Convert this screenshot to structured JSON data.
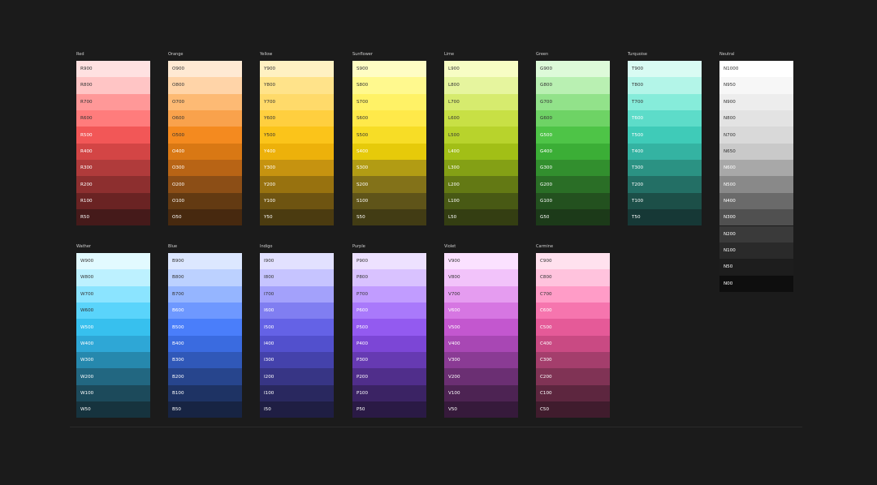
{
  "palettes_row1": [
    {
      "title": "Red",
      "swatches": [
        {
          "label": "R900",
          "bg": "#FFE1E1",
          "fg": "#333333"
        },
        {
          "label": "R800",
          "bg": "#FFC5C5",
          "fg": "#333333"
        },
        {
          "label": "R700",
          "bg": "#FF9898",
          "fg": "#333333"
        },
        {
          "label": "R600",
          "bg": "#FF7C7C",
          "fg": "#333333"
        },
        {
          "label": "R500",
          "bg": "#F25757",
          "fg": "#ffffff"
        },
        {
          "label": "R400",
          "bg": "#D34545",
          "fg": "#ffffff"
        },
        {
          "label": "R300",
          "bg": "#B03B3B",
          "fg": "#ffffff"
        },
        {
          "label": "R200",
          "bg": "#8D2F2F",
          "fg": "#ffffff"
        },
        {
          "label": "R100",
          "bg": "#6A2323",
          "fg": "#ffffff"
        },
        {
          "label": "R50",
          "bg": "#451A1A",
          "fg": "#ffffff"
        }
      ]
    },
    {
      "title": "Orange",
      "swatches": [
        {
          "label": "O900",
          "bg": "#FFE9D3",
          "fg": "#333333"
        },
        {
          "label": "O800",
          "bg": "#FFD4A8",
          "fg": "#333333"
        },
        {
          "label": "O700",
          "bg": "#FDBA74",
          "fg": "#333333"
        },
        {
          "label": "O600",
          "bg": "#F9A24C",
          "fg": "#333333"
        },
        {
          "label": "O500",
          "bg": "#F48A1F",
          "fg": "#333333"
        },
        {
          "label": "O400",
          "bg": "#D97814",
          "fg": "#ffffff"
        },
        {
          "label": "O300",
          "bg": "#B86415",
          "fg": "#ffffff"
        },
        {
          "label": "O200",
          "bg": "#8C4E16",
          "fg": "#ffffff"
        },
        {
          "label": "O100",
          "bg": "#633A12",
          "fg": "#ffffff"
        },
        {
          "label": "O50",
          "bg": "#47290F",
          "fg": "#ffffff"
        }
      ]
    },
    {
      "title": "Yellow",
      "swatches": [
        {
          "label": "Y900",
          "bg": "#FFF1C2",
          "fg": "#333333"
        },
        {
          "label": "Y800",
          "bg": "#FFE38A",
          "fg": "#333333"
        },
        {
          "label": "Y700",
          "bg": "#FFDA6A",
          "fg": "#333333"
        },
        {
          "label": "Y600",
          "bg": "#FFCF3F",
          "fg": "#333333"
        },
        {
          "label": "Y500",
          "bg": "#FBC41A",
          "fg": "#333333"
        },
        {
          "label": "Y400",
          "bg": "#EDB10A",
          "fg": "#ffffff"
        },
        {
          "label": "Y300",
          "bg": "#C69310",
          "fg": "#ffffff"
        },
        {
          "label": "Y200",
          "bg": "#98720F",
          "fg": "#ffffff"
        },
        {
          "label": "Y100",
          "bg": "#6E5411",
          "fg": "#ffffff"
        },
        {
          "label": "Y50",
          "bg": "#4B3B10",
          "fg": "#ffffff"
        }
      ]
    },
    {
      "title": "Sunflower",
      "swatches": [
        {
          "label": "S900",
          "bg": "#FFFDC4",
          "fg": "#333333"
        },
        {
          "label": "S800",
          "bg": "#FFF98E",
          "fg": "#333333"
        },
        {
          "label": "S700",
          "bg": "#FFF266",
          "fg": "#333333"
        },
        {
          "label": "S600",
          "bg": "#FFE94A",
          "fg": "#333333"
        },
        {
          "label": "S500",
          "bg": "#F7DD26",
          "fg": "#333333"
        },
        {
          "label": "S400",
          "bg": "#E6CA0A",
          "fg": "#ffffff"
        },
        {
          "label": "S300",
          "bg": "#B29C14",
          "fg": "#ffffff"
        },
        {
          "label": "S200",
          "bg": "#837219",
          "fg": "#ffffff"
        },
        {
          "label": "S100",
          "bg": "#5F5419",
          "fg": "#ffffff"
        },
        {
          "label": "S50",
          "bg": "#423C14",
          "fg": "#ffffff"
        }
      ]
    },
    {
      "title": "Lime",
      "swatches": [
        {
          "label": "L900",
          "bg": "#F7FDC4",
          "fg": "#333333"
        },
        {
          "label": "L800",
          "bg": "#E6F59E",
          "fg": "#333333"
        },
        {
          "label": "L700",
          "bg": "#D6EB6E",
          "fg": "#333333"
        },
        {
          "label": "L600",
          "bg": "#C8E045",
          "fg": "#333333"
        },
        {
          "label": "L500",
          "bg": "#B8D32C",
          "fg": "#333333"
        },
        {
          "label": "L400",
          "bg": "#A2BF16",
          "fg": "#ffffff"
        },
        {
          "label": "L300",
          "bg": "#84A015",
          "fg": "#ffffff"
        },
        {
          "label": "L200",
          "bg": "#637914",
          "fg": "#ffffff"
        },
        {
          "label": "L100",
          "bg": "#485914",
          "fg": "#ffffff"
        },
        {
          "label": "L50",
          "bg": "#343E12",
          "fg": "#ffffff"
        }
      ]
    },
    {
      "title": "Green",
      "swatches": [
        {
          "label": "G900",
          "bg": "#DDFAD9",
          "fg": "#333333"
        },
        {
          "label": "G800",
          "bg": "#B9F0B2",
          "fg": "#333333"
        },
        {
          "label": "G700",
          "bg": "#92E28A",
          "fg": "#333333"
        },
        {
          "label": "G600",
          "bg": "#6ED365",
          "fg": "#333333"
        },
        {
          "label": "G500",
          "bg": "#4EC447",
          "fg": "#ffffff"
        },
        {
          "label": "G400",
          "bg": "#3BAE36",
          "fg": "#ffffff"
        },
        {
          "label": "G300",
          "bg": "#328F2E",
          "fg": "#ffffff"
        },
        {
          "label": "G200",
          "bg": "#2A6E26",
          "fg": "#ffffff"
        },
        {
          "label": "G100",
          "bg": "#23511F",
          "fg": "#ffffff"
        },
        {
          "label": "G50",
          "bg": "#1C3A19",
          "fg": "#ffffff"
        }
      ]
    },
    {
      "title": "Turquoise",
      "swatches": [
        {
          "label": "T900",
          "bg": "#D9FBF3",
          "fg": "#333333"
        },
        {
          "label": "T800",
          "bg": "#B3F5E8",
          "fg": "#333333"
        },
        {
          "label": "T700",
          "bg": "#86ECDA",
          "fg": "#333333"
        },
        {
          "label": "T600",
          "bg": "#5DDCC9",
          "fg": "#ffffff"
        },
        {
          "label": "T500",
          "bg": "#3FCBB8",
          "fg": "#ffffff"
        },
        {
          "label": "T400",
          "bg": "#34B3A2",
          "fg": "#ffffff"
        },
        {
          "label": "T300",
          "bg": "#2B9283",
          "fg": "#ffffff"
        },
        {
          "label": "T200",
          "bg": "#236F65",
          "fg": "#ffffff"
        },
        {
          "label": "T100",
          "bg": "#1C4F48",
          "fg": "#ffffff"
        },
        {
          "label": "T50",
          "bg": "#163836",
          "fg": "#ffffff"
        }
      ]
    },
    {
      "title": "Neutral",
      "swatches": [
        {
          "label": "N1000",
          "bg": "#FFFFFF",
          "fg": "#333333"
        },
        {
          "label": "N950",
          "bg": "#F7F7F7",
          "fg": "#333333"
        },
        {
          "label": "N900",
          "bg": "#EDEDED",
          "fg": "#333333"
        },
        {
          "label": "N800",
          "bg": "#E3E3E3",
          "fg": "#333333"
        },
        {
          "label": "N700",
          "bg": "#D9D9D9",
          "fg": "#333333"
        },
        {
          "label": "N650",
          "bg": "#C9C9C9",
          "fg": "#333333"
        },
        {
          "label": "N600",
          "bg": "#A8A8A8",
          "fg": "#ffffff"
        },
        {
          "label": "N500",
          "bg": "#898989",
          "fg": "#ffffff"
        },
        {
          "label": "N400",
          "bg": "#6A6A6A",
          "fg": "#ffffff"
        },
        {
          "label": "N300",
          "bg": "#505050",
          "fg": "#ffffff"
        },
        {
          "label": "N200",
          "bg": "#3A3A3A",
          "fg": "#ffffff"
        },
        {
          "label": "N100",
          "bg": "#2A2A2A",
          "fg": "#ffffff"
        },
        {
          "label": "N50",
          "bg": "#1D1D1D",
          "fg": "#ffffff"
        },
        {
          "label": "N00",
          "bg": "#0E0E0E",
          "fg": "#ffffff"
        }
      ]
    }
  ],
  "palettes_row2": [
    {
      "title": "Wather",
      "swatches": [
        {
          "label": "W900",
          "bg": "#E2FAFF",
          "fg": "#333333"
        },
        {
          "label": "W800",
          "bg": "#BDF1FF",
          "fg": "#333333"
        },
        {
          "label": "W700",
          "bg": "#8BE4FF",
          "fg": "#333333"
        },
        {
          "label": "W600",
          "bg": "#5AD4FB",
          "fg": "#333333"
        },
        {
          "label": "W500",
          "bg": "#37C0EE",
          "fg": "#ffffff"
        },
        {
          "label": "W400",
          "bg": "#2EA7D6",
          "fg": "#ffffff"
        },
        {
          "label": "W300",
          "bg": "#2688AD",
          "fg": "#ffffff"
        },
        {
          "label": "W200",
          "bg": "#226781",
          "fg": "#ffffff"
        },
        {
          "label": "W100",
          "bg": "#1C4A5B",
          "fg": "#ffffff"
        },
        {
          "label": "W50",
          "bg": "#16333E",
          "fg": "#ffffff"
        }
      ]
    },
    {
      "title": "Blue",
      "swatches": [
        {
          "label": "B900",
          "bg": "#DCE7FF",
          "fg": "#333333"
        },
        {
          "label": "B800",
          "bg": "#BCD1FF",
          "fg": "#333333"
        },
        {
          "label": "B700",
          "bg": "#95B5FF",
          "fg": "#333333"
        },
        {
          "label": "B600",
          "bg": "#6E98FF",
          "fg": "#ffffff"
        },
        {
          "label": "B500",
          "bg": "#4A7EFA",
          "fg": "#ffffff"
        },
        {
          "label": "B400",
          "bg": "#3A6BE0",
          "fg": "#ffffff"
        },
        {
          "label": "B300",
          "bg": "#3058B8",
          "fg": "#ffffff"
        },
        {
          "label": "B200",
          "bg": "#27458D",
          "fg": "#ffffff"
        },
        {
          "label": "B100",
          "bg": "#1E3364",
          "fg": "#ffffff"
        },
        {
          "label": "B50",
          "bg": "#172443",
          "fg": "#ffffff"
        }
      ]
    },
    {
      "title": "Indigo",
      "swatches": [
        {
          "label": "I900",
          "bg": "#E2E1FF",
          "fg": "#333333"
        },
        {
          "label": "I800",
          "bg": "#C6C4FF",
          "fg": "#333333"
        },
        {
          "label": "I700",
          "bg": "#A3A1FB",
          "fg": "#333333"
        },
        {
          "label": "I600",
          "bg": "#807EF1",
          "fg": "#ffffff"
        },
        {
          "label": "I500",
          "bg": "#6462E6",
          "fg": "#ffffff"
        },
        {
          "label": "I400",
          "bg": "#5250CD",
          "fg": "#ffffff"
        },
        {
          "label": "I300",
          "bg": "#4442AB",
          "fg": "#ffffff"
        },
        {
          "label": "I200",
          "bg": "#373585",
          "fg": "#ffffff"
        },
        {
          "label": "I100",
          "bg": "#29285F",
          "fg": "#ffffff"
        },
        {
          "label": "I50",
          "bg": "#1F1E43",
          "fg": "#ffffff"
        }
      ]
    },
    {
      "title": "Purple",
      "swatches": [
        {
          "label": "P900",
          "bg": "#EDE1FF",
          "fg": "#333333"
        },
        {
          "label": "P800",
          "bg": "#D9C2FF",
          "fg": "#333333"
        },
        {
          "label": "P700",
          "bg": "#C19CFF",
          "fg": "#333333"
        },
        {
          "label": "P600",
          "bg": "#A979FB",
          "fg": "#ffffff"
        },
        {
          "label": "P500",
          "bg": "#935AF0",
          "fg": "#ffffff"
        },
        {
          "label": "P400",
          "bg": "#7C46D6",
          "fg": "#ffffff"
        },
        {
          "label": "P300",
          "bg": "#663AB2",
          "fg": "#ffffff"
        },
        {
          "label": "P200",
          "bg": "#502E8B",
          "fg": "#ffffff"
        },
        {
          "label": "P100",
          "bg": "#3B2364",
          "fg": "#ffffff"
        },
        {
          "label": "P50",
          "bg": "#2A1A45",
          "fg": "#ffffff"
        }
      ]
    },
    {
      "title": "Violet",
      "swatches": [
        {
          "label": "V900",
          "bg": "#FBE1FF",
          "fg": "#333333"
        },
        {
          "label": "V800",
          "bg": "#F2C3FA",
          "fg": "#333333"
        },
        {
          "label": "V700",
          "bg": "#E59CF0",
          "fg": "#333333"
        },
        {
          "label": "V600",
          "bg": "#D676E2",
          "fg": "#ffffff"
        },
        {
          "label": "V500",
          "bg": "#C357CF",
          "fg": "#ffffff"
        },
        {
          "label": "V400",
          "bg": "#A847B4",
          "fg": "#ffffff"
        },
        {
          "label": "V300",
          "bg": "#8A3B94",
          "fg": "#ffffff"
        },
        {
          "label": "V200",
          "bg": "#6B2F73",
          "fg": "#ffffff"
        },
        {
          "label": "V100",
          "bg": "#4D2353",
          "fg": "#ffffff"
        },
        {
          "label": "V50",
          "bg": "#361A3B",
          "fg": "#ffffff"
        }
      ]
    },
    {
      "title": "Carmine",
      "swatches": [
        {
          "label": "C900",
          "bg": "#FFE1EE",
          "fg": "#333333"
        },
        {
          "label": "C800",
          "bg": "#FFC3DD",
          "fg": "#333333"
        },
        {
          "label": "C700",
          "bg": "#FF9CC7",
          "fg": "#333333"
        },
        {
          "label": "C600",
          "bg": "#F675AE",
          "fg": "#ffffff"
        },
        {
          "label": "C500",
          "bg": "#E55A98",
          "fg": "#ffffff"
        },
        {
          "label": "C400",
          "bg": "#C94A83",
          "fg": "#ffffff"
        },
        {
          "label": "C300",
          "bg": "#A43E6C",
          "fg": "#ffffff"
        },
        {
          "label": "C200",
          "bg": "#803355",
          "fg": "#ffffff"
        },
        {
          "label": "C100",
          "bg": "#5D263F",
          "fg": "#ffffff"
        },
        {
          "label": "C50",
          "bg": "#401C2D",
          "fg": "#ffffff"
        }
      ]
    }
  ]
}
